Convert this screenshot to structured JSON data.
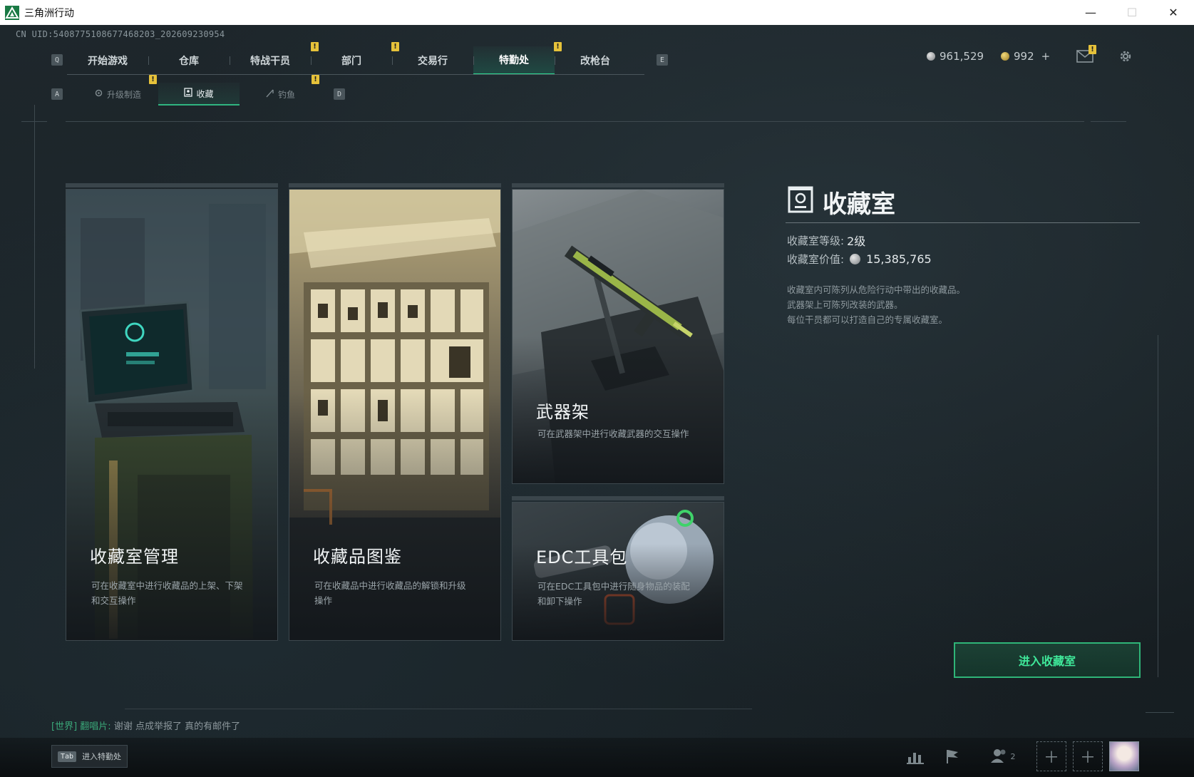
{
  "window": {
    "title": "三角洲行动",
    "minimize": "—",
    "maximize": "☐",
    "close": "✕"
  },
  "uid": "CN UID:5408775108677468203_202609230954",
  "nav": {
    "key_left": "Q",
    "key_right": "E",
    "tabs": [
      {
        "label": "开始游戏"
      },
      {
        "label": "仓库"
      },
      {
        "label": "特战干员"
      },
      {
        "label": "部门"
      },
      {
        "label": "交易行"
      },
      {
        "label": "特勤处",
        "active": true
      },
      {
        "label": "改枪台"
      }
    ],
    "badge": "!"
  },
  "subnav": {
    "key_left": "A",
    "key_right": "D",
    "tabs": [
      {
        "label": "升级制造",
        "icon": "gear-wrench-icon"
      },
      {
        "label": "收藏",
        "icon": "collection-icon",
        "active": true
      },
      {
        "label": "钓鱼",
        "icon": "fishing-icon"
      }
    ]
  },
  "currency": {
    "silver": "961,529",
    "gold": "992",
    "add": "+"
  },
  "cards": [
    {
      "title": "收藏室管理",
      "desc_line1": "可在收藏室中进行收藏品的上架、下架",
      "desc_line2": "和交互操作"
    },
    {
      "title": "收藏品图鉴",
      "desc_line1": "可在收藏品中进行收藏品的解锁和升级",
      "desc_line2": "操作"
    },
    {
      "title": "武器架",
      "desc_line1": "可在武器架中进行收藏武器的交互操作",
      "desc_line2": ""
    },
    {
      "title": "EDC工具包",
      "desc_line1": "可在EDC工具包中进行随身物品的装配",
      "desc_line2": "和卸下操作"
    }
  ],
  "info": {
    "title": "收藏室",
    "level_label": "收藏室等级:",
    "level_value": "2级",
    "value_label": "收藏室价值:",
    "value_value": "15,385,765",
    "desc_line1": "收藏室内可陈列从危险行动中带出的收藏品。",
    "desc_line2": "武器架上可陈列改装的武器。",
    "desc_line3": "每位干员都可以打造自己的专属收藏室。"
  },
  "enter_button": "进入收藏室",
  "chat": {
    "channel": "[世界]",
    "sender": "翻唱片:",
    "message": "谢谢 点成举报了 真的有邮件了"
  },
  "bottom": {
    "tab_key": "Tab",
    "tab_label": "进入特勤处",
    "friends_count": "2"
  },
  "colors": {
    "accent": "#2fd590",
    "badge": "#e6c23a"
  }
}
